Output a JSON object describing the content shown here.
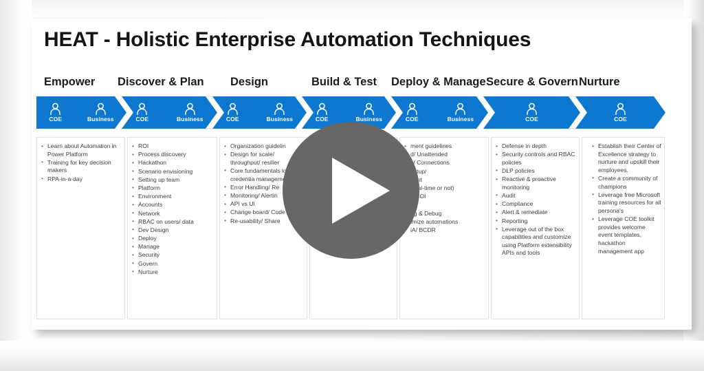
{
  "slide": {
    "title": "HEAT - Holistic Enterprise Automation Techniques"
  },
  "player": {
    "play_label": "Play"
  },
  "personas": {
    "coe": "COE",
    "business": "Business"
  },
  "phases": [
    {
      "label": "Empower",
      "personas": [
        "COE",
        "Business"
      ],
      "bullets": [
        "Learn about Automation in Power Platform",
        "Training for key decision makers",
        "RPA-in-a-day"
      ]
    },
    {
      "label": "Discover & Plan",
      "personas": [
        "COE",
        "Business"
      ],
      "bullets": [
        "ROI",
        "Process discovery",
        "Hackathon",
        "Scenario envisioning",
        "Setting up team",
        "Platform",
        "Environment",
        "Accounts",
        "Network",
        "RBAC on users/ data",
        "Dev Design",
        "Deploy",
        "Manage",
        "Security",
        "Govern",
        "Nurture"
      ]
    },
    {
      "label": "Design",
      "personas": [
        "COE",
        "Business"
      ],
      "bullets": [
        "Organization guidelin",
        "Design for scale/ throughput/ resilier",
        "Core fundamentals logging/ credentia management/ test",
        "Error Handling/ Re",
        "Monitoring/ Alertin",
        "API vs UI",
        "Change board/ Code review",
        "Re-usability/ Share"
      ]
    },
    {
      "label": "Build & Test",
      "personas": [
        "COE",
        "Business"
      ],
      "bullets": []
    },
    {
      "label": "Deploy & Manage",
      "personas": [
        "COE",
        "Business"
      ],
      "bullets": [
        "ment guidelines",
        "d/ Unattended",
        "s/ Connections",
        "setup/",
        "nent",
        "(real-time or not)",
        "e ROI",
        "ie",
        "ng & Debug",
        "imize automations",
        "iA/ BCDR"
      ]
    },
    {
      "label": "Secure & Govern",
      "personas": [
        "COE"
      ],
      "bullets": [
        "Defense in depth",
        "Security controls and RBAC policies",
        "DLP policies",
        "Reactive & proactive monitoring",
        "Audit",
        "Compliance",
        "Alert & remediate",
        "Reporting",
        "Leverage out of the box capabilities and customize using Platform extensibility APIs and tools"
      ]
    },
    {
      "label": "Nurture",
      "personas": [
        "COE"
      ],
      "bullets": [
        "Establish their Center of Excellence strategy to nurture and upskill their employees.",
        "Create a community of champions",
        "Leverage free Microsoft training resources for all persona's",
        "Leverage COE toolkit provides welcome event templates, hackathon management app"
      ]
    }
  ],
  "colors": {
    "chevron_blue": "#0e77d0",
    "play_overlay": "#676767",
    "slide_background": "#ffffff"
  }
}
